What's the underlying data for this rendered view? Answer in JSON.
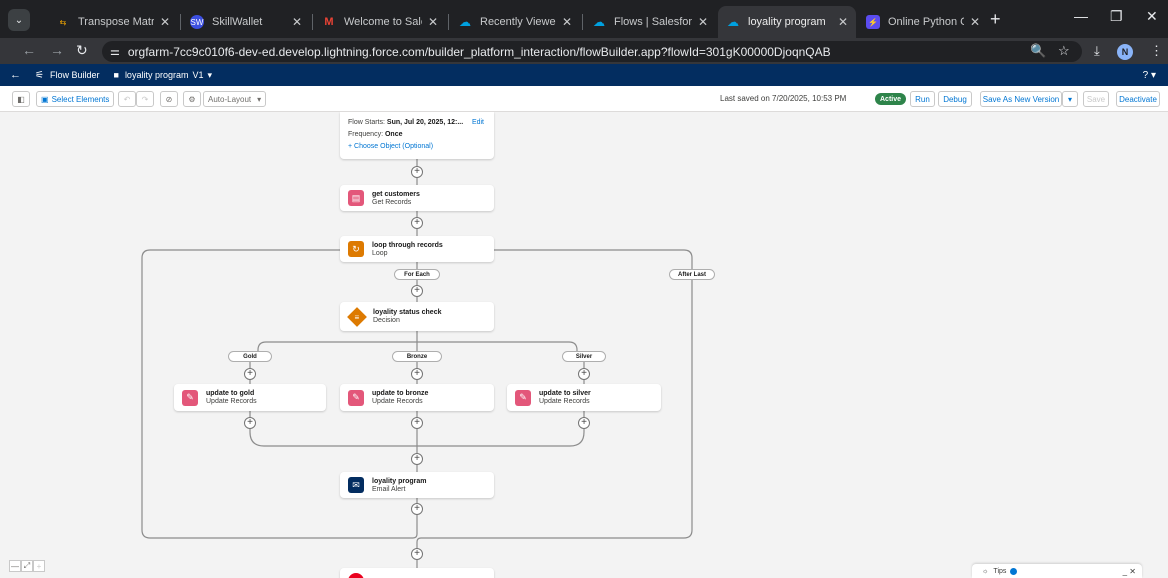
{
  "browser": {
    "tabs": [
      {
        "label": "Transpose Matrix",
        "favicon": "⇆",
        "favcolor": "#f9ab00"
      },
      {
        "label": "SkillWallet",
        "favicon": "SW",
        "favcolor": "#3c4fe0"
      },
      {
        "label": "Welcome to Salesf",
        "favicon": "M",
        "favcolor": "#ea4335"
      },
      {
        "label": "Recently Viewed |",
        "favicon": "☁",
        "favcolor": "#00a1e0"
      },
      {
        "label": "Flows | Salesforce",
        "favicon": "☁",
        "favcolor": "#00a1e0"
      },
      {
        "label": "loyality program",
        "favicon": "☁",
        "favcolor": "#00a1e0"
      },
      {
        "label": "Online Python Co",
        "favicon": "⚡",
        "favcolor": "#5b4cf0"
      }
    ],
    "active_tab_index": 5,
    "url": "orgfarm-7cc9c010f6-dev-ed.develop.lightning.force.com/builder_platform_interaction/flowBuilder.app?flowId=301gK00000DjoqnQAB",
    "profile_initial": "N"
  },
  "header": {
    "app_title": "Flow Builder",
    "flow_name": "loyality program",
    "version": "V1",
    "help": "?"
  },
  "toolbar": {
    "select_elements": "Select Elements",
    "auto_layout": "Auto-Layout",
    "last_saved": "Last saved on 7/20/2025, 10:53 PM",
    "status_badge": "Active",
    "run": "Run",
    "debug": "Debug",
    "save_as_new_version": "Save As New Version",
    "save": "Save",
    "deactivate": "Deactivate"
  },
  "start_node": {
    "flow_starts_label": "Flow Starts:",
    "flow_starts_value": "Sun, Jul 20, 2025, 12:...",
    "edit": "Edit",
    "frequency_label": "Frequency:",
    "frequency_value": "Once",
    "choose_object": "Choose Object (Optional)"
  },
  "nodes": {
    "get_customers": {
      "label": "get customers",
      "type": "Get Records"
    },
    "loop": {
      "label": "loop through records",
      "type": "Loop"
    },
    "decision": {
      "label": "loyality status check",
      "type": "Decision"
    },
    "update_gold": {
      "label": "update to gold",
      "type": "Update Records"
    },
    "update_bronze": {
      "label": "update to bronze",
      "type": "Update Records"
    },
    "update_silver": {
      "label": "update to silver",
      "type": "Update Records"
    },
    "email": {
      "label": "loyality program",
      "type": "Email Alert"
    }
  },
  "paths": {
    "for_each": "For Each",
    "after_last": "After Last",
    "gold": "Gold",
    "bronze": "Bronze",
    "silver": "Silver"
  },
  "tips": {
    "label": "Tips"
  },
  "colors": {
    "records": "#e3577a",
    "loop": "#dd7a01",
    "decision": "#dd7a01",
    "email": "#032d60",
    "end": "#ea001e",
    "header": "#032d60"
  }
}
